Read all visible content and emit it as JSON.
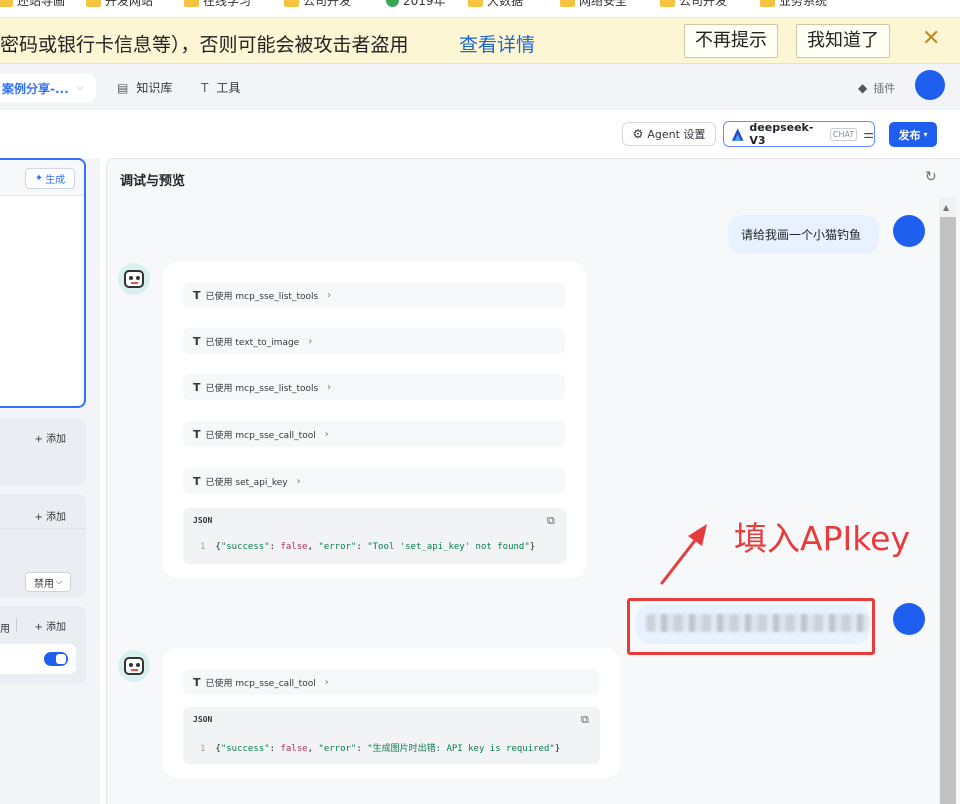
{
  "bookmarks": [
    {
      "label": "还站导画",
      "type": "folder"
    },
    {
      "label": "开发网站",
      "type": "folder"
    },
    {
      "label": "在线学习",
      "type": "folder"
    },
    {
      "label": "公司开发",
      "type": "folder"
    },
    {
      "label": "2019年",
      "type": "globe"
    },
    {
      "label": "大数据",
      "type": "folder"
    },
    {
      "label": "网络安全",
      "type": "folder"
    },
    {
      "label": "公司开发",
      "type": "folder"
    },
    {
      "label": "业务系统",
      "type": "folder"
    }
  ],
  "warning": {
    "text": "密码或银行卡信息等），否则可能会被攻击者盗用",
    "link": "查看详情",
    "dont_show_again": "不再提示",
    "got_it": "我知道了",
    "close": "✕"
  },
  "header": {
    "project": "案例分享-...",
    "nav": [
      {
        "label": "知识库",
        "icon": "book-icon"
      },
      {
        "label": "工具",
        "icon": "hammer-icon"
      }
    ],
    "plugin": "插件"
  },
  "toolbar": {
    "agent_settings": "Agent 设置",
    "model_name": "deepseek-V3",
    "model_badge": "CHAT",
    "publish": "发布"
  },
  "left_panel": {
    "generate": "生成",
    "add": "+ 添加",
    "disable": "禁用",
    "partial": "用"
  },
  "preview": {
    "title": "调试与预览",
    "messages": [
      {
        "role": "user",
        "text": "请给我画一个小猫钓鱼"
      },
      {
        "role": "bot",
        "tools": [
          "已使用 mcp_sse_list_tools",
          "已使用 text_to_image",
          "已使用 mcp_sse_list_tools",
          "已使用 mcp_sse_call_tool",
          "已使用 set_api_key"
        ],
        "json_label": "JSON",
        "json_line": "1",
        "json": {
          "k1": "\"success\"",
          "v1": "false",
          "k2": "\"error\"",
          "v2": "\"Tool 'set_api_key' not found\""
        }
      },
      {
        "role": "user",
        "text": "",
        "redacted": true
      },
      {
        "role": "bot",
        "tools": [
          "已使用 mcp_sse_call_tool"
        ],
        "json_label": "JSON",
        "json_line": "1",
        "json": {
          "k1": "\"success\"",
          "v1": "false",
          "k2": "\"error\"",
          "v2": "\"生成图片时出错: API key is required\""
        }
      }
    ]
  },
  "annotation": {
    "text": "填入APIkey",
    "color": "#e83b3b"
  },
  "colors": {
    "accent": "#1f5ff0",
    "link": "#3370ff",
    "warning_bg": "#fdf6d5"
  }
}
